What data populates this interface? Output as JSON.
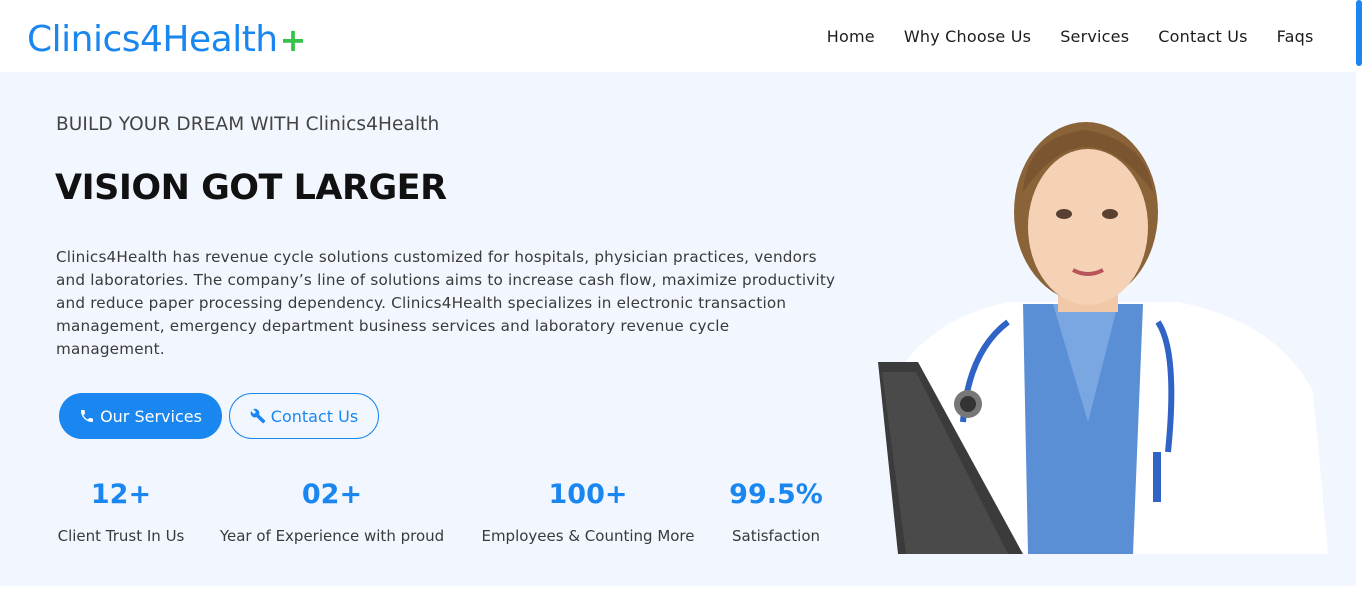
{
  "header": {
    "logo_text": "Clinics4Health",
    "logo_plus": "+",
    "nav": [
      {
        "label": "Home"
      },
      {
        "label": "Why Choose Us"
      },
      {
        "label": "Services"
      },
      {
        "label": "Contact Us"
      },
      {
        "label": "Faqs"
      }
    ]
  },
  "hero": {
    "subtitle": "BUILD YOUR DREAM WITH Clinics4Health",
    "title": "VISION GOT LARGER",
    "description": "Clinics4Health has revenue cycle solutions customized for hospitals, physician practices, vendors and laboratories. The company’s line of solutions aims to increase cash flow, maximize productivity and reduce paper processing dependency. Clinics4Health specializes in electronic transaction management, emergency department business services and laboratory revenue cycle management.",
    "primary_button": {
      "label": "Our Services",
      "icon": "phone-icon"
    },
    "secondary_button": {
      "label": "Contact Us",
      "icon": "tools-icon"
    },
    "stats": [
      {
        "value": "12+",
        "label": "Client Trust In Us"
      },
      {
        "value": "02+",
        "label": "Year of Experience with proud"
      },
      {
        "value": "100+",
        "label": "Employees & Counting More"
      },
      {
        "value": "99.5%",
        "label": "Satisfaction"
      }
    ],
    "image": "doctor-photo"
  },
  "colors": {
    "brand_blue": "#1a87f0",
    "brand_green": "#37c24a",
    "hero_background": "#f2f6fe"
  }
}
